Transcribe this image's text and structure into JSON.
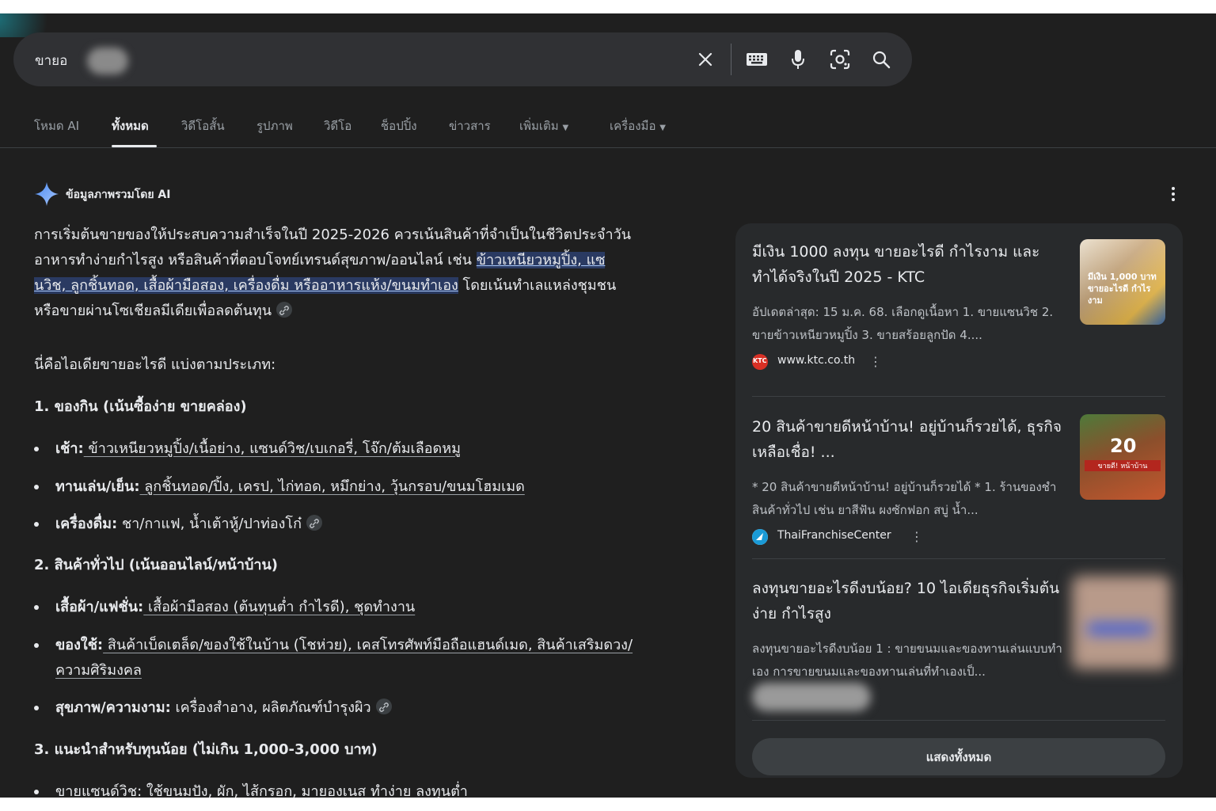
{
  "search": {
    "query_visible": "ขายอ"
  },
  "tabs": [
    {
      "label": "โหมด AI"
    },
    {
      "label": "ทั้งหมด"
    },
    {
      "label": "วิดีโอสั้น"
    },
    {
      "label": "รูปภาพ"
    },
    {
      "label": "วิดีโอ"
    },
    {
      "label": "ช็อปปิ้ง"
    },
    {
      "label": "ข่าวสาร"
    },
    {
      "label": "เพิ่มเติม"
    },
    {
      "label": "เครื่องมือ"
    }
  ],
  "ai_overview": {
    "label": "ข้อมูลภาพรวมโดย AI",
    "intro_lines": [
      "การเริ่มต้นขายของให้ประสบความสำเร็จในปี 2025-2026 ควรเน้นสินค้าที่จำเป็นในชีวิตประจำวัน",
      "อาหารทำง่ายกำไรสูง หรือสินค้าที่ตอบโจทย์เทรนด์สุขภาพ/ออนไลน์ เช่น ",
      "ข้าวเหนียวหมูปิ้ง, แซ",
      "นวิช, ลูกชิ้นทอด, เสื้อผ้ามือสอง, เครื่องดื่ม หรืออาหารแห้ง/ขนมทำเอง",
      " โดยเน้นทำเลแหล่งชุมชน",
      "หรือขายผ่านโซเชียลมีเดียเพื่อลดต้นทุน"
    ],
    "ideas_intro": "นี่คือไอเดียขายอะไรดี แบ่งตามประเภท:",
    "sections": [
      {
        "heading": "1. ของกิน (เน้นซื้อง่าย ขายคล่อง)",
        "bullets": [
          {
            "label": "เช้า:",
            "text": " ข้าวเหนียวหมูปิ้ง/เนื้อย่าง, แซนด์วิช/เบเกอรี่, โจ๊ก/ต้มเลือดหมู"
          },
          {
            "label": "ทานเล่น/เย็น:",
            "text": " ลูกชิ้นทอด/ปิ้ง, เครป, ไก่ทอด, หมึกย่าง, วุ้นกรอบ/ขนมโฮมเมด"
          },
          {
            "label": "เครื่องดื่ม:",
            "text": " ชา/กาแฟ, น้ำเต้าหู้/ปาท่องโก๋"
          }
        ]
      },
      {
        "heading": "2. สินค้าทั่วไป (เน้นออนไลน์/หน้าบ้าน)",
        "bullets": [
          {
            "label": "เสื้อผ้า/แฟชั่น:",
            "text": " เสื้อผ้ามือสอง (ต้นทุนต่ำ กำไรดี), ชุดทำงาน"
          },
          {
            "label": "ของใช้:",
            "text": " สินค้าเบ็ดเตล็ด/ของใช้ในบ้าน (โชห่วย), เคสโทรศัพท์มือถือแฮนด์เมด, สินค้าเสริมดวง/",
            "text2": "ความศิริมงคล"
          },
          {
            "label": "สุขภาพ/ความงาม:",
            "text": " เครื่องสำอาง, ผลิตภัณฑ์บำรุงผิว"
          }
        ]
      },
      {
        "heading": "3. แนะนำสำหรับทุนน้อย (ไม่เกิน 1,000-3,000 บาท)",
        "bullets": [
          {
            "label": "ขายแซนด์วิช",
            "text": ": ใช้ขนมปัง, ผัก, ไส้กรอก, มายองเนส ทำง่าย ลงทุนต่ำ"
          }
        ]
      }
    ]
  },
  "sources": [
    {
      "title": "มีเงิน 1000 ลงทุน ขายอะไรดี กำไรงาม และทำได้จริงในปี 2025 - KTC",
      "snippet": "อัปเดตล่าสุด: 15 ม.ค. 68. เลือกดูเนื้อหา 1. ขายแซนวิช 2. ขายข้าวเหนียวหมูปิ้ง 3. ขายสร้อยลูกปัด 4....",
      "site": "www.ktc.co.th",
      "favicon_text": "KTC",
      "thumb_text": "มีเงิน 1,000 บาท ขายอะไรดี กำไรงาม"
    },
    {
      "title": "20 สินค้าขายดีหน้าบ้าน! อยู่บ้านก็รวยได้, ธุรกิจเหลือเชื่อ! ...",
      "snippet": "* 20 สินค้าขายดีหน้าบ้าน! อยู่บ้านก็รวยได้ * 1. ร้านของชำ สินค้าทั่วไป เช่น ยาสีฟัน ผงซักฟอก สบู่ น้ำ...",
      "site": "ThaiFranchiseCenter",
      "thumb_text": "20",
      "thumb_caption": "ขายดี! หน้าบ้าน"
    },
    {
      "title": "ลงทุนขายอะไรดีงบน้อย? 10 ไอเดียธุรกิจเริ่มต้นง่าย กำไรสูง",
      "snippet": "ลงทุนขายอะไรดีงบน้อย 1 : ขายขนมและของทานเล่นแบบทำเอง การขายขนมและของทานเล่นที่ทำเองเป็...",
      "site": ""
    }
  ],
  "show_all": "แสดงทั้งหมด",
  "colors": {
    "background": "#1f1f1f",
    "searchbar": "#303134",
    "panel": "#282a2c",
    "highlight": "#2a3a62"
  },
  "icons": [
    "close-icon",
    "keyboard-icon",
    "mic-icon",
    "lens-icon",
    "search-icon",
    "sparkle-icon",
    "link-icon",
    "more-vert-icon"
  ]
}
